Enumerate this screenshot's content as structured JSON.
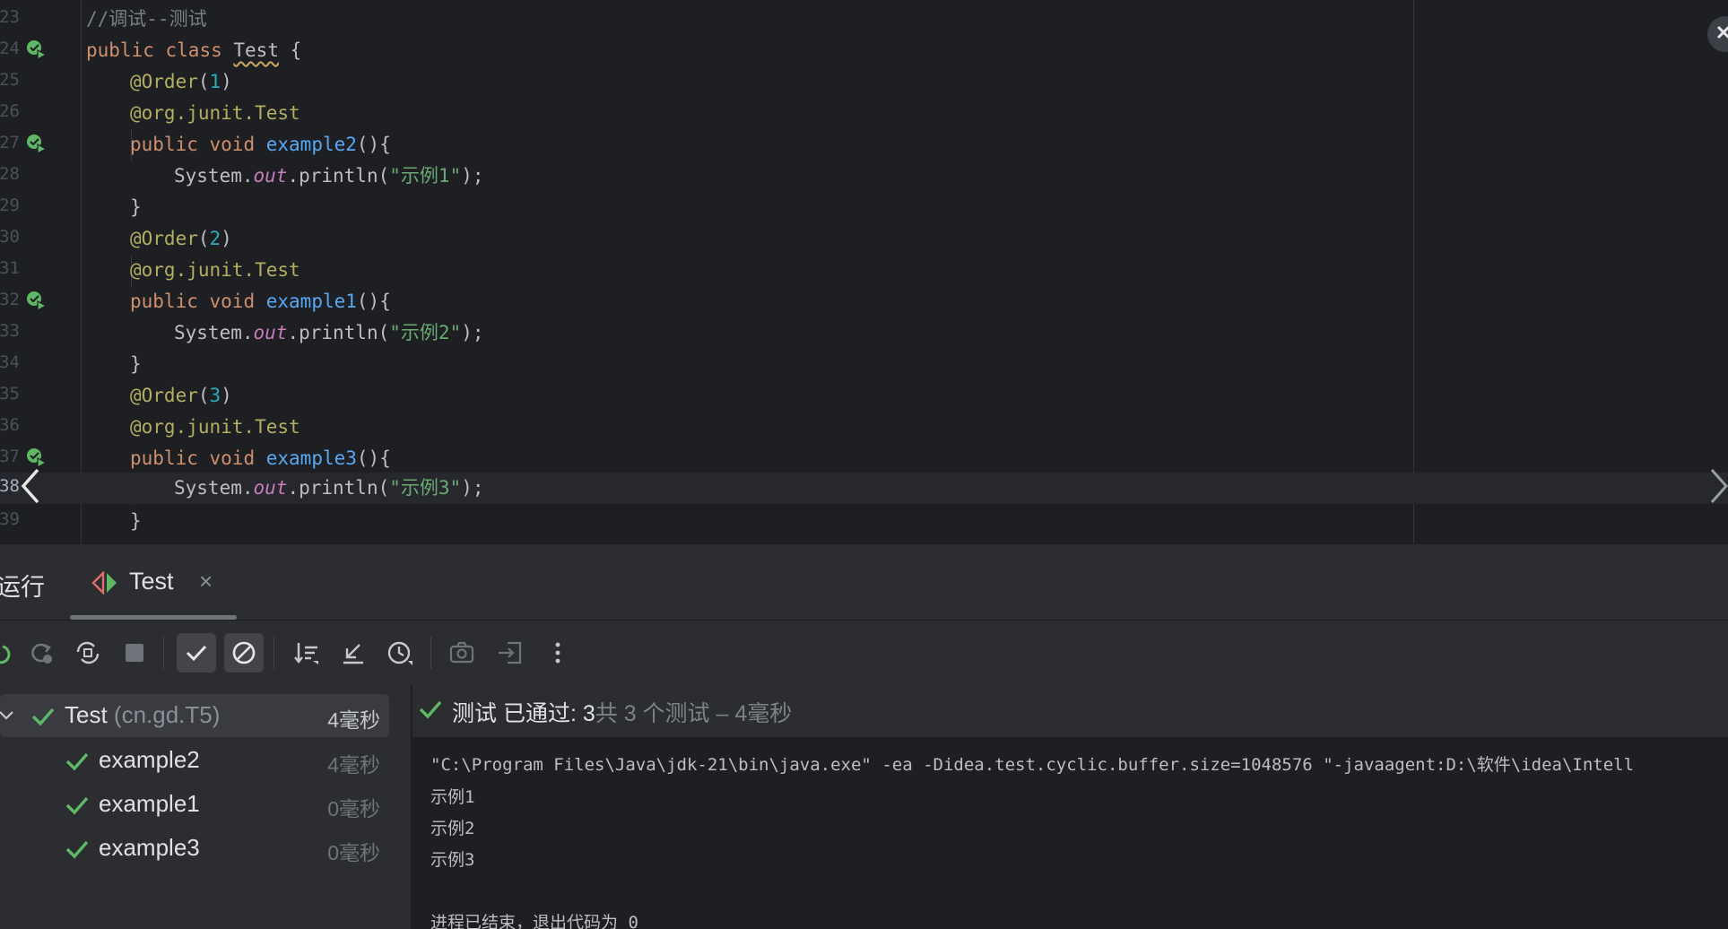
{
  "editor": {
    "lines": [
      {
        "num": "23",
        "code": "//调试--测试"
      },
      {
        "num": "24",
        "code": "public class Test {"
      },
      {
        "num": "25",
        "code": "@Order(1)"
      },
      {
        "num": "26",
        "code": "@org.junit.Test"
      },
      {
        "num": "27",
        "code": "public void example2(){"
      },
      {
        "num": "28",
        "code": "System.out.println(\"示例1\");"
      },
      {
        "num": "29",
        "code": "}"
      },
      {
        "num": "30",
        "code": "@Order(2)"
      },
      {
        "num": "31",
        "code": "@org.junit.Test"
      },
      {
        "num": "32",
        "code": "public void example1(){"
      },
      {
        "num": "33",
        "code": "System.out.println(\"示例2\");"
      },
      {
        "num": "34",
        "code": "}"
      },
      {
        "num": "35",
        "code": "@Order(3)"
      },
      {
        "num": "36",
        "code": "@org.junit.Test"
      },
      {
        "num": "37",
        "code": "public void example3(){"
      },
      {
        "num": "38",
        "code": "System.out.println(\"示例3\");"
      },
      {
        "num": "39",
        "code": "}"
      }
    ],
    "tokens": {
      "comment": "//调试--测试",
      "kw_public": "public",
      "kw_class": "class",
      "kw_void": "void",
      "class_name": "Test",
      "open_brace": " {",
      "ann_order": "@Order",
      "ann_junit_pkg": "@org.junit.",
      "ann_junit_test": "Test",
      "m1": "example2",
      "m2": "example1",
      "m3": "example3",
      "order1": "1",
      "order2": "2",
      "order3": "3",
      "paren_open": "(",
      "paren_close": ")",
      "sig_end": "(){",
      "sys": "System.",
      "out": "out",
      "println": ".println(",
      "s1": "\"示例1\"",
      "s2": "\"示例2\"",
      "s3": "\"示例3\"",
      "stmt_end": ");",
      "close_brace": "}"
    }
  },
  "tool_window": {
    "title": "运行",
    "tab_label": "Test",
    "tab_close": "×"
  },
  "toolbar": {
    "buttons": [
      "rerun-icon",
      "rerun-failed-icon",
      "toggle-auto-test-icon",
      "stop-icon",
      "show-passed-icon",
      "show-ignored-icon",
      "sort-icon",
      "collapse-icon",
      "history-icon",
      "camera-icon",
      "export-icon",
      "more-icon"
    ]
  },
  "test_tree": {
    "root": {
      "name": "Test",
      "package": "(cn.gd.T5)",
      "time": "4毫秒"
    },
    "children": [
      {
        "name": "example2",
        "time": "4毫秒"
      },
      {
        "name": "example1",
        "time": "0毫秒"
      },
      {
        "name": "example3",
        "time": "0毫秒"
      }
    ]
  },
  "console": {
    "status_label": "测试 已通过: ",
    "status_count": "3",
    "status_summary": "共 3 个测试 – 4毫秒",
    "command": "\"C:\\Program Files\\Java\\jdk-21\\bin\\java.exe\" -ea -Didea.test.cyclic.buffer.size=1048576 \"-javaagent:D:\\软件\\idea\\Intell",
    "outputs": [
      "示例1",
      "示例2",
      "示例3"
    ],
    "exit_message": "进程已结束，退出代码为 0"
  },
  "colors": {
    "editor_bg": "#1e1f22",
    "panel_bg": "#2b2d30",
    "keyword": "#cf8e6d",
    "annotation": "#b3ae60",
    "method": "#56a8f5",
    "number": "#2aacb8",
    "string": "#6aab73",
    "success": "#5fb865"
  }
}
